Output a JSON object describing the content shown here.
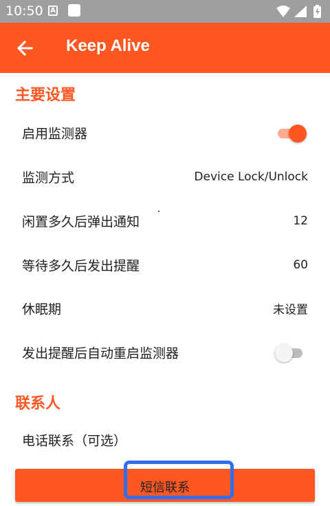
{
  "status_bar": {
    "time": "10:50",
    "notification_letter": "A"
  },
  "app_bar": {
    "title": "Keep Alive"
  },
  "main_settings": {
    "title": "主要设置",
    "enable_monitor": {
      "label": "启用监测器",
      "enabled": true
    },
    "monitor_mode": {
      "label": "监测方式",
      "value": "Device Lock/Unlock"
    },
    "idle_notify": {
      "label": "闲置多久后弹出通知",
      "value": "12"
    },
    "wait_alert": {
      "label": "等待多久后发出提醒",
      "value": "60"
    },
    "rest_period": {
      "label": "休眠期",
      "value": "未设置"
    },
    "auto_restart": {
      "label": "发出提醒后自动重启监测器",
      "enabled": false
    }
  },
  "contacts": {
    "title": "联系人",
    "phone_contact": {
      "label": "电话联系（可选）"
    },
    "sms_button": {
      "label": "短信联系"
    }
  },
  "colors": {
    "accent": "#ff5722",
    "status_bar": "#9e9e9e",
    "highlight": "#2f6ff0"
  }
}
